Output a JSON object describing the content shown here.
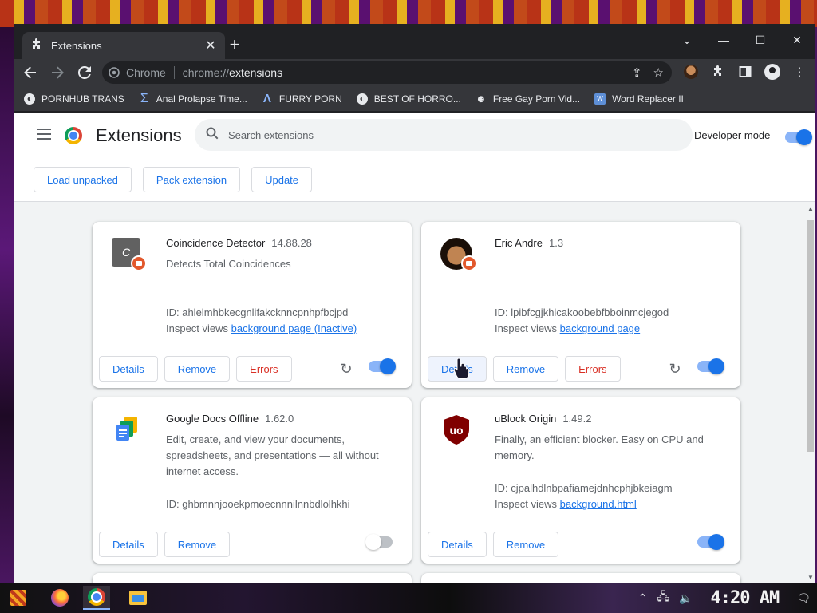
{
  "window": {
    "tab_title": "Extensions",
    "tab_close": "✕",
    "new_tab": "+",
    "controls": {
      "minimize": "—",
      "maximize": "☐",
      "close": "✕",
      "tab_search": "⌄"
    }
  },
  "toolbar": {
    "site_name": "Chrome",
    "url_scheme": "chrome://",
    "url_host": "extensions"
  },
  "bookmarks": [
    {
      "label": "PORNHUB TRANS",
      "icon": "globe-icon"
    },
    {
      "label": "Anal Prolapse Time...",
      "icon": "sigma-icon"
    },
    {
      "label": "FURRY PORN",
      "icon": "lambda-icon"
    },
    {
      "label": "BEST OF HORRO...",
      "icon": "globe-icon"
    },
    {
      "label": "Free Gay Porn Vid...",
      "icon": "mask-icon"
    },
    {
      "label": "Word Replacer II",
      "icon": "word-replacer-icon"
    }
  ],
  "extensions_page": {
    "title": "Extensions",
    "search_placeholder": "Search extensions",
    "developer_mode_label": "Developer mode",
    "developer_mode": true,
    "actions": {
      "load_unpacked": "Load unpacked",
      "pack_extension": "Pack extension",
      "update": "Update"
    }
  },
  "extensions": [
    {
      "name": "Coincidence Detector",
      "version": "14.88.28",
      "description": "Detects Total Coincidences",
      "id_label": "ID: ahlelmhbkecgnlifakcknncpnhpfbcjpd",
      "inspect_label": "Inspect views",
      "inspect_link": "background page (Inactive)",
      "icon_letter": "C",
      "buttons": {
        "details": "Details",
        "remove": "Remove",
        "errors": "Errors"
      },
      "enabled": true
    },
    {
      "name": "Eric Andre",
      "version": "1.3",
      "description": "",
      "id_label": "ID: lpibfcgjkhlcakoobebfbboinmcjegod",
      "inspect_label": "Inspect views",
      "inspect_link": "background page",
      "buttons": {
        "details": "Details",
        "remove": "Remove",
        "errors": "Errors"
      },
      "enabled": true
    },
    {
      "name": "Google Docs Offline",
      "version": "1.62.0",
      "description": "Edit, create, and view your documents, spreadsheets, and presentations — all without internet access.",
      "id_label": "ID: ghbmnnjooekpmoecnnnilnnbdlolhkhi",
      "buttons": {
        "details": "Details",
        "remove": "Remove"
      },
      "enabled": false
    },
    {
      "name": "uBlock Origin",
      "version": "1.49.2",
      "description": "Finally, an efficient blocker. Easy on CPU and memory.",
      "id_label": "ID: cjpalhdlnbpafiamejdnhcphjbkeiagm",
      "inspect_label": "Inspect views",
      "inspect_link": "background.html",
      "icon_letters": "uo",
      "buttons": {
        "details": "Details",
        "remove": "Remove"
      },
      "enabled": true
    }
  ],
  "taskbar": {
    "clock": "4:20 AM",
    "tray_icons": [
      "chevron-up-icon",
      "network-icon",
      "volume-icon",
      "notification-icon"
    ]
  },
  "colors": {
    "accent": "#1a73e8",
    "error": "#d93025",
    "frame": "#202124",
    "toolbar": "#35363a",
    "page_bg": "#f1f3f4"
  }
}
